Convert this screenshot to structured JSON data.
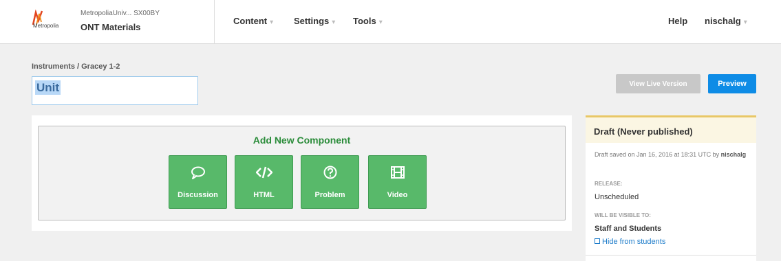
{
  "header": {
    "org_line": "MetropoliaUniv...  SX00BY",
    "course_title": "ONT Materials",
    "logo_text": "Metropolia",
    "nav": [
      {
        "label": "Content"
      },
      {
        "label": "Settings"
      },
      {
        "label": "Tools"
      }
    ],
    "help": "Help",
    "user": "nischalg",
    "caret": "▾"
  },
  "title_area": {
    "breadcrumb": "Instruments  /  Gracey 1-2",
    "unit_name": "Unit",
    "view_live": "View Live Version",
    "preview": "Preview"
  },
  "add_component": {
    "title": "Add New Component",
    "buttons": [
      {
        "label": "Discussion",
        "icon": "speech-bubble-icon"
      },
      {
        "label": "HTML",
        "icon": "code-icon"
      },
      {
        "label": "Problem",
        "icon": "question-circle-icon"
      },
      {
        "label": "Video",
        "icon": "film-icon"
      }
    ]
  },
  "sidebar": {
    "status_title": "Draft (Never published)",
    "saved_prefix": "Draft saved on ",
    "saved_date": "Jan 16, 2016 at 18:31 UTC",
    "saved_by_prefix": " by ",
    "saved_by": "nischalg",
    "release_label": "RELEASE:",
    "release_value": "Unscheduled",
    "visible_label": "WILL BE VISIBLE TO:",
    "visible_value": "Staff and Students",
    "hide_link": "Hide from students"
  },
  "colors": {
    "accent_blue": "#0e8ce6",
    "component_green": "#58b96a",
    "title_green": "#2b8c3a",
    "draft_border": "#e8c766"
  }
}
